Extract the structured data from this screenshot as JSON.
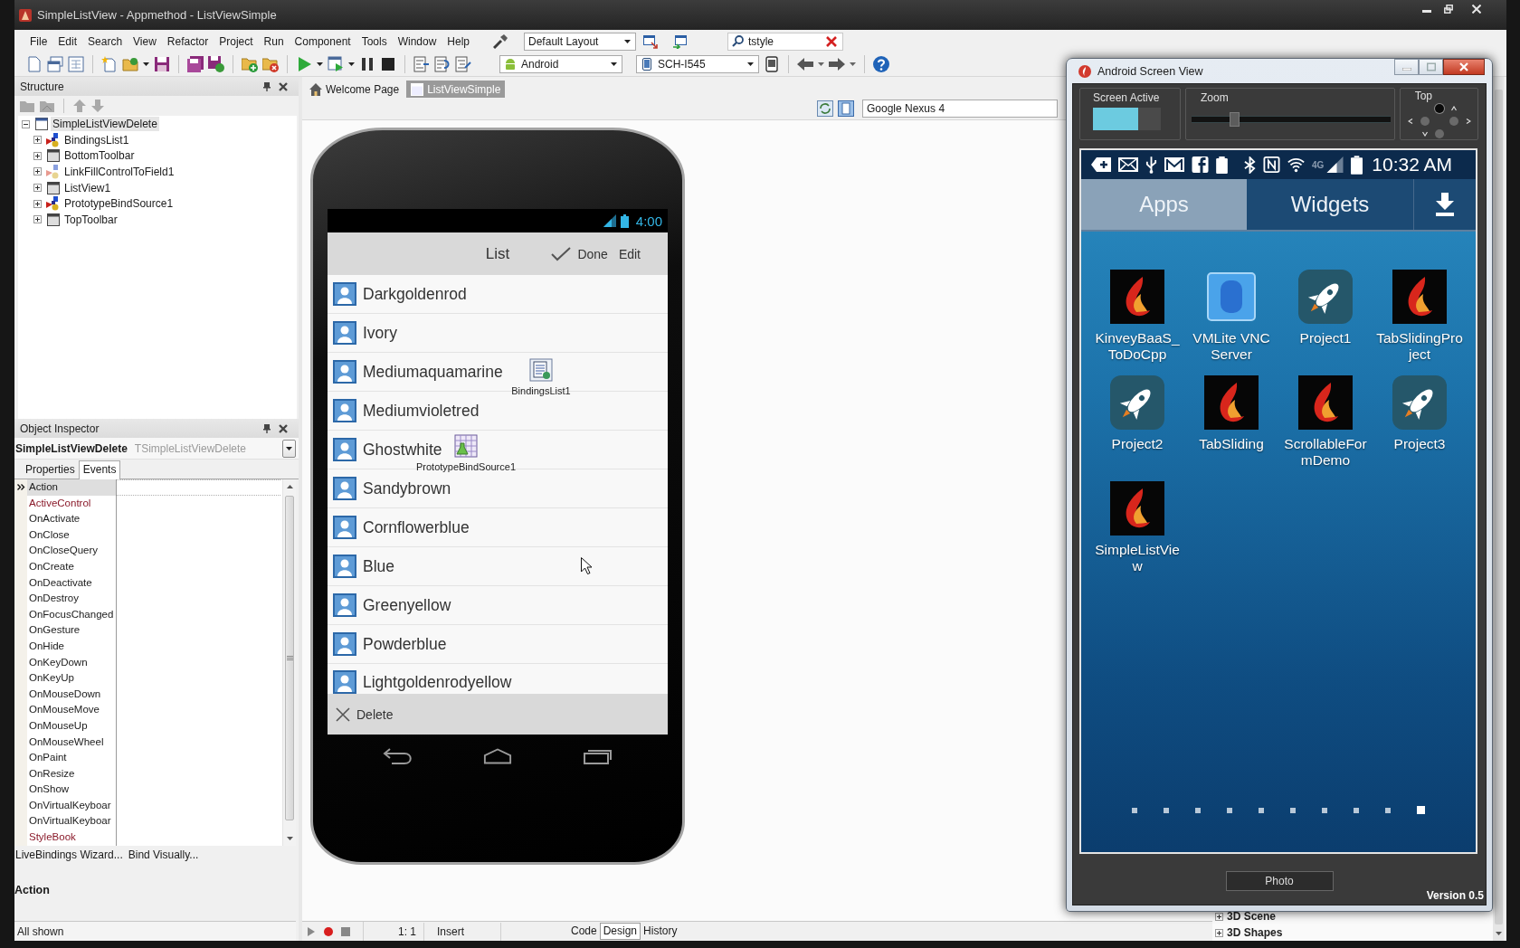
{
  "window": {
    "title": "SimpleListView - Appmethod - ListViewSimple"
  },
  "menu": [
    "File",
    "Edit",
    "Search",
    "View",
    "Refactor",
    "Project",
    "Run",
    "Component",
    "Tools",
    "Window",
    "Help"
  ],
  "layout_combo": {
    "value": "Default Layout"
  },
  "search": {
    "value": "tstyle"
  },
  "toolbar": {
    "platform": "Android",
    "device": "SCH-I545"
  },
  "structure": {
    "title": "Structure",
    "tree": [
      {
        "label": "SimpleListViewDelete",
        "kind": "form",
        "expanded": true,
        "selected": true,
        "children": [
          {
            "label": "BindingsList1",
            "kind": "bindings",
            "expanded": false,
            "selected": false
          },
          {
            "label": "BottomToolbar",
            "kind": "control",
            "expanded": false,
            "selected": false
          },
          {
            "label": "LinkFillControlToField1",
            "kind": "link",
            "expanded": false,
            "selected": false
          },
          {
            "label": "ListView1",
            "kind": "control",
            "expanded": false,
            "selected": false
          },
          {
            "label": "PrototypeBindSource1",
            "kind": "bindings",
            "expanded": false,
            "selected": false
          },
          {
            "label": "TopToolbar",
            "kind": "control",
            "expanded": false,
            "selected": false
          }
        ]
      }
    ]
  },
  "inspector": {
    "title": "Object Inspector",
    "object": "SimpleListViewDelete",
    "type": "TSimpleListViewDelete",
    "tabs": [
      {
        "label": "Properties",
        "selected": false
      },
      {
        "label": "Events",
        "selected": true
      }
    ],
    "rows": [
      {
        "name": "Action",
        "kind": "plain",
        "selected": true
      },
      {
        "name": "ActiveControl",
        "kind": "reference",
        "selected": false
      },
      {
        "name": "OnActivate",
        "kind": "plain",
        "selected": false
      },
      {
        "name": "OnClose",
        "kind": "plain",
        "selected": false
      },
      {
        "name": "OnCloseQuery",
        "kind": "plain",
        "selected": false
      },
      {
        "name": "OnCreate",
        "kind": "plain",
        "selected": false
      },
      {
        "name": "OnDeactivate",
        "kind": "plain",
        "selected": false
      },
      {
        "name": "OnDestroy",
        "kind": "plain",
        "selected": false
      },
      {
        "name": "OnFocusChanged",
        "kind": "plain",
        "selected": false
      },
      {
        "name": "OnGesture",
        "kind": "plain",
        "selected": false
      },
      {
        "name": "OnHide",
        "kind": "plain",
        "selected": false
      },
      {
        "name": "OnKeyDown",
        "kind": "plain",
        "selected": false
      },
      {
        "name": "OnKeyUp",
        "kind": "plain",
        "selected": false
      },
      {
        "name": "OnMouseDown",
        "kind": "plain",
        "selected": false
      },
      {
        "name": "OnMouseMove",
        "kind": "plain",
        "selected": false
      },
      {
        "name": "OnMouseUp",
        "kind": "plain",
        "selected": false
      },
      {
        "name": "OnMouseWheel",
        "kind": "plain",
        "selected": false
      },
      {
        "name": "OnPaint",
        "kind": "plain",
        "selected": false
      },
      {
        "name": "OnResize",
        "kind": "plain",
        "selected": false
      },
      {
        "name": "OnShow",
        "kind": "plain",
        "selected": false
      },
      {
        "name": "OnVirtualKeyboar",
        "kind": "plain",
        "selected": false
      },
      {
        "name": "OnVirtualKeyboar",
        "kind": "plain",
        "selected": false
      },
      {
        "name": "StyleBook",
        "kind": "reference",
        "selected": false
      }
    ],
    "links": [
      "LiveBindings Wizard...",
      "Bind Visually..."
    ],
    "description_title": "Action",
    "filter": "All shown"
  },
  "editor_tabs": [
    {
      "label": "Welcome Page",
      "kind": "home",
      "selected": false
    },
    {
      "label": "ListViewSimple",
      "kind": "unit",
      "selected": true
    }
  ],
  "view_combo": {
    "value": "Google Nexus 4"
  },
  "phone": {
    "time": "4:00",
    "title": "List",
    "actions": [
      {
        "label": "Done",
        "kind": "check"
      },
      {
        "label": "Edit",
        "kind": "plain"
      }
    ],
    "items": [
      "Darkgoldenrod",
      "Ivory",
      "Mediumaquamarine",
      "Mediumvioletred",
      "Ghostwhite",
      "Sandybrown",
      "Cornflowerblue",
      "Blue",
      "Greenyellow",
      "Powderblue",
      "Lightgoldenrodyellow"
    ],
    "bottom_action": {
      "label": "Delete"
    }
  },
  "components": [
    {
      "label": "BindingsList1",
      "kind": "bindings"
    },
    {
      "label": "PrototypeBindSource1",
      "kind": "bindsource"
    }
  ],
  "status_bar": {
    "position": "1: 1",
    "mode": "Insert",
    "view_tabs": [
      {
        "label": "Code",
        "selected": false
      },
      {
        "label": "Design",
        "selected": true
      },
      {
        "label": "History",
        "selected": false
      }
    ]
  },
  "palette": [
    "3D Scene",
    "3D Shapes"
  ],
  "screen_view": {
    "title": "Android Screen View",
    "screen_active": {
      "label": "Screen Active",
      "on": true
    },
    "zoom": {
      "label": "Zoom",
      "level": 0.2
    },
    "direction": {
      "label": "Top",
      "options": [
        {
          "kind": "up",
          "selected": true
        },
        {
          "kind": "left",
          "selected": false
        },
        {
          "kind": "right",
          "selected": false
        },
        {
          "kind": "down",
          "selected": false
        }
      ]
    },
    "device": {
      "network": "4G",
      "time": "10:32 AM",
      "tabs": [
        {
          "label": "Apps",
          "selected": true
        },
        {
          "label": "Widgets",
          "selected": false
        }
      ],
      "apps": [
        {
          "label_lines": [
            "KinveyBaaS_",
            "ToDoCpp"
          ],
          "kind": "flame"
        },
        {
          "label_lines": [
            "VMLite VNC",
            "Server"
          ],
          "kind": "vnc"
        },
        {
          "label_lines": [
            "Project1"
          ],
          "kind": "rocket"
        },
        {
          "label_lines": [
            "TabSlidingPro",
            "ject"
          ],
          "kind": "flame"
        },
        {
          "label_lines": [
            "Project2"
          ],
          "kind": "rocket"
        },
        {
          "label_lines": [
            "TabSliding"
          ],
          "kind": "flame"
        },
        {
          "label_lines": [
            "ScrollableFor",
            "mDemo"
          ],
          "kind": "flame"
        },
        {
          "label_lines": [
            "Project3"
          ],
          "kind": "rocket"
        },
        {
          "label_lines": [
            "SimpleListVie",
            "w"
          ],
          "kind": "flame"
        }
      ],
      "pages": [
        {
          "selected": false
        },
        {
          "selected": false
        },
        {
          "selected": false
        },
        {
          "selected": false
        },
        {
          "selected": false
        },
        {
          "selected": false
        },
        {
          "selected": false
        },
        {
          "selected": false
        },
        {
          "selected": false
        },
        {
          "selected": true
        }
      ]
    },
    "photo_button": "Photo",
    "version": "Version 0.5"
  }
}
